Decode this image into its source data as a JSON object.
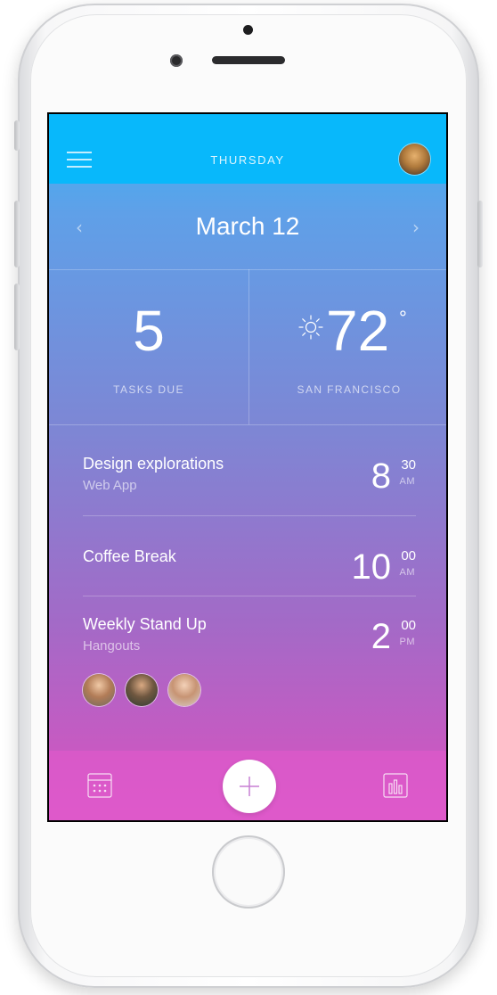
{
  "header": {
    "day": "THURSDAY"
  },
  "date_nav": {
    "date": "March 12",
    "prev_icon": "‹",
    "next_icon": "›"
  },
  "stats": {
    "tasks_due_count": "5",
    "tasks_due_label": "TASKS DUE",
    "temperature": "72",
    "degree_symbol": "°",
    "location": "SAN FRANCISCO",
    "weather_icon": "sun-icon"
  },
  "events": [
    {
      "title": "Design explorations",
      "subtitle": "Web App",
      "hour": "8",
      "minute": "30",
      "ampm": "AM"
    },
    {
      "title": "Coffee Break",
      "subtitle": "",
      "hour": "10",
      "minute": "00",
      "ampm": "AM"
    },
    {
      "title": "Weekly Stand Up",
      "subtitle": "Hangouts",
      "hour": "2",
      "minute": "00",
      "ampm": "PM"
    }
  ],
  "tab_bar": {
    "left_icon": "calendar-icon",
    "center_icon": "plus-icon",
    "right_icon": "bar-chart-icon"
  },
  "colors": {
    "status_bar": "#08b8fb",
    "gradient_top": "#38b4f5",
    "gradient_bottom": "#d659c6"
  }
}
